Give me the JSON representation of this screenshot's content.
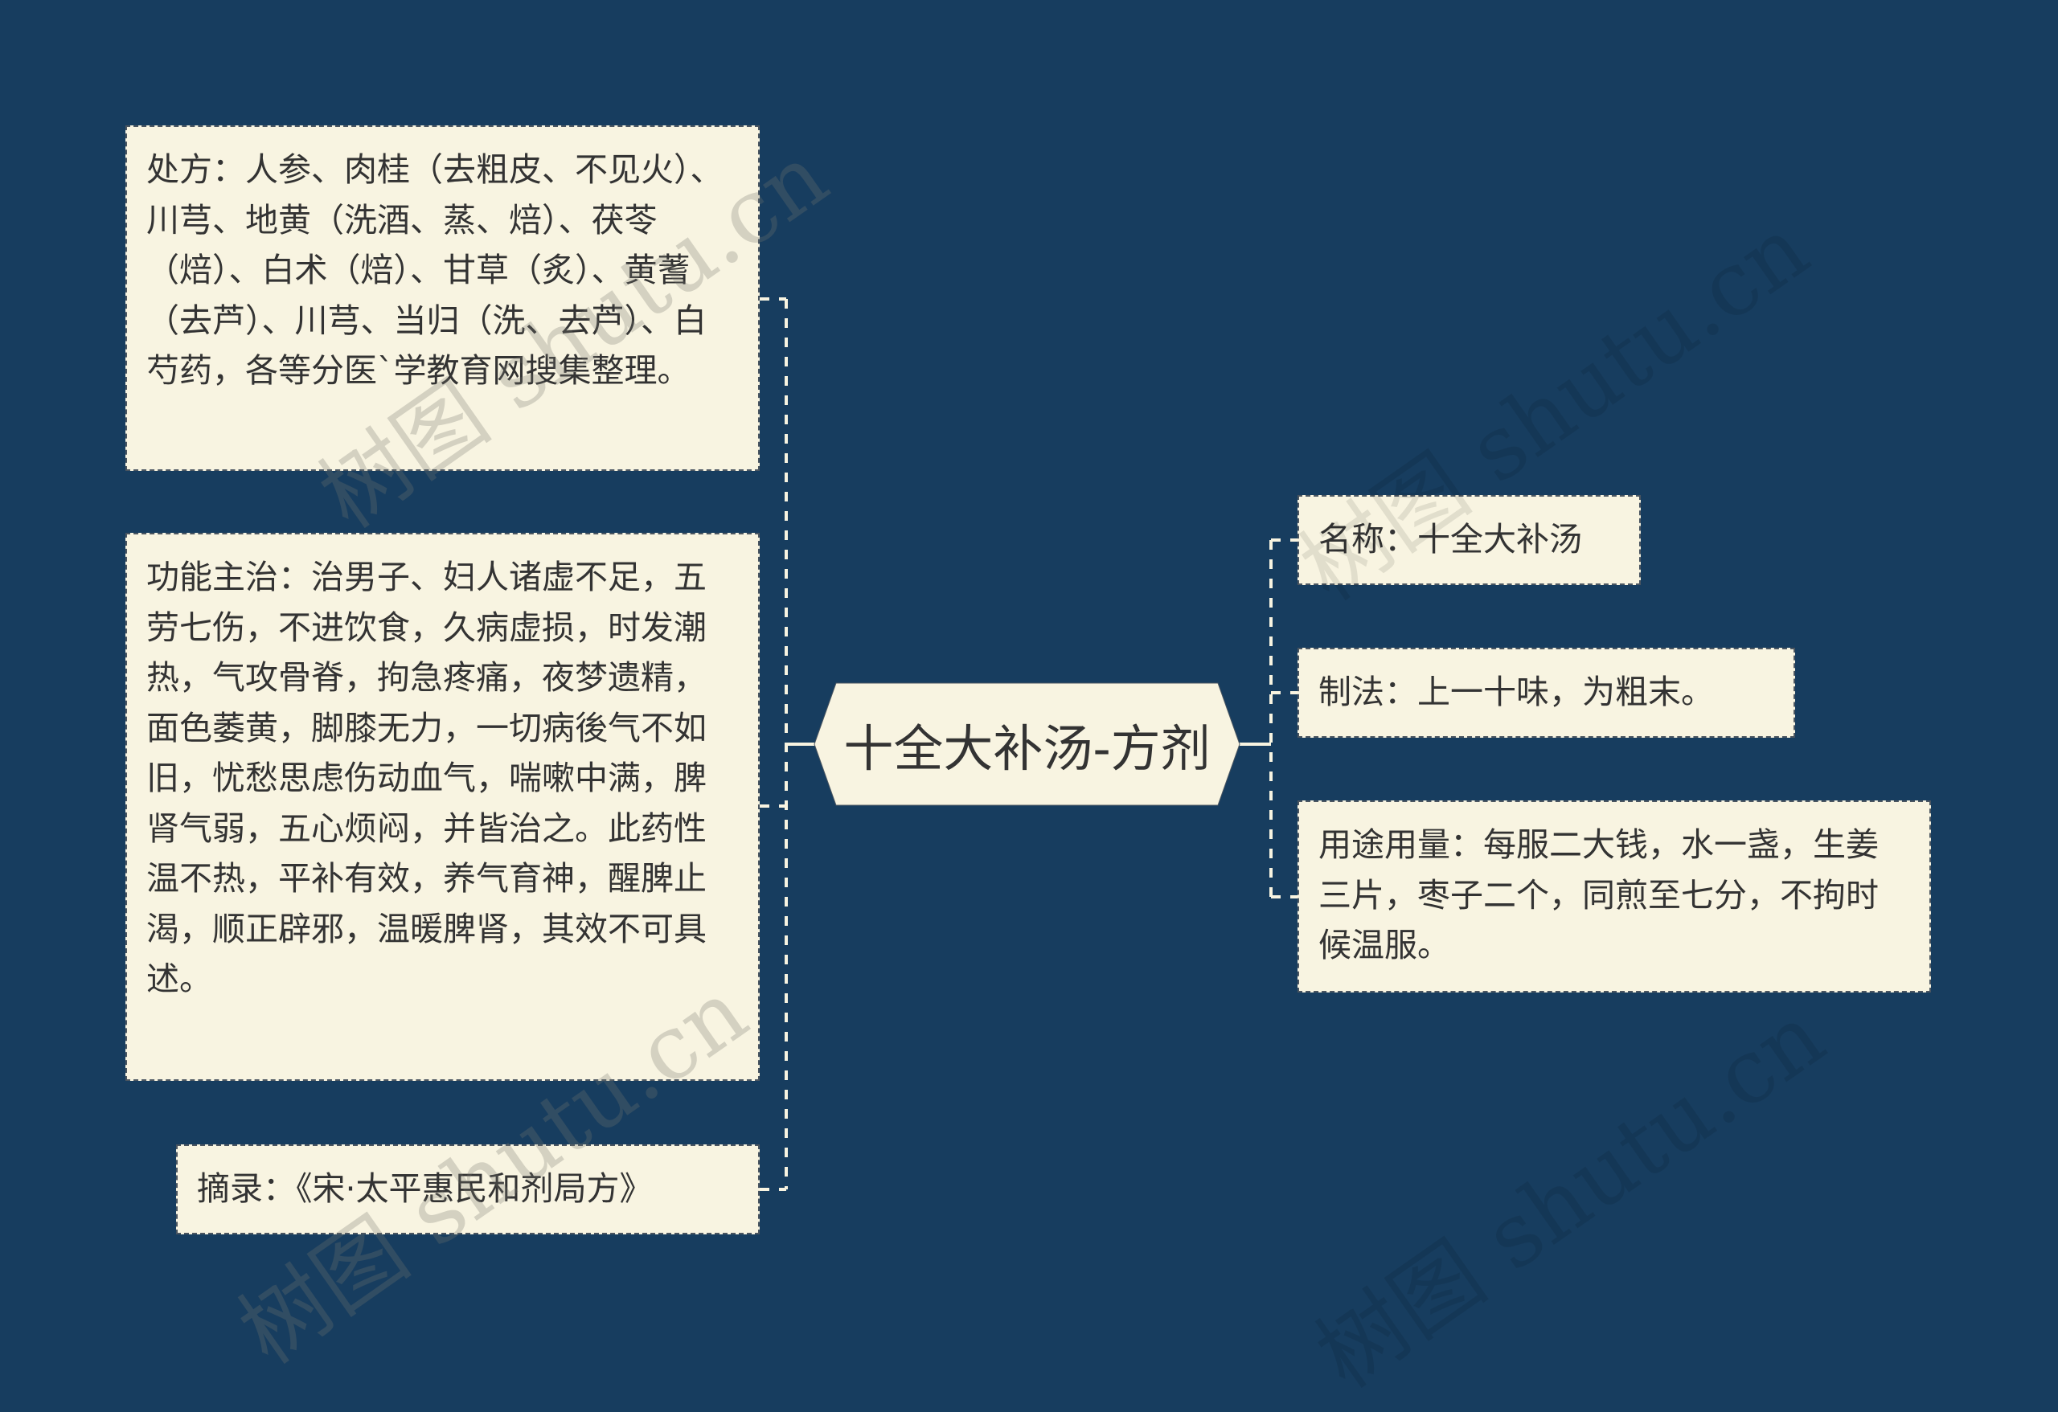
{
  "diagram": {
    "type": "mind-map",
    "colors": {
      "background": "#173d5f",
      "node_fill": "#f8f4e1",
      "node_border": "#4a5560",
      "text": "#333333",
      "connector": "#f8f4e1"
    },
    "center": {
      "title": "十全大补汤-方剂"
    },
    "left_branches": [
      {
        "id": "prescription",
        "text": "处方：人参、肉桂（去粗皮、不见火）、川芎、地黄（洗酒、蒸、焙）、茯苓（焙）、白术（焙）、甘草（炙）、黄蓍（去芦）、川芎、当归（洗、去芦）、白芍药，各等分医`学教育网搜集整理。"
      },
      {
        "id": "indications",
        "text": "功能主治：治男子、妇人诸虚不足，五劳七伤，不进饮食，久病虚损，时发潮热，气攻骨脊，拘急疼痛，夜梦遗精，面色萎黄，脚膝无力，一切病後气不如旧，忧愁思虑伤动血气，喘嗽中满，脾肾气弱，五心烦闷，并皆治之。此药性温不热，平补有效，养气育神，醒脾止渴，顺正辟邪，温暖脾肾，其效不可具述。"
      },
      {
        "id": "source",
        "text": "摘录：《宋·太平惠民和剂局方》"
      }
    ],
    "right_branches": [
      {
        "id": "name",
        "text": "名称：十全大补汤"
      },
      {
        "id": "preparation",
        "text": "制法：上一十味，为粗末。"
      },
      {
        "id": "usage",
        "text": "用途用量：每服二大钱，水一盏，生姜三片，枣子二个，同煎至七分，不拘时候温服。"
      }
    ]
  },
  "watermark": {
    "text_latin": "shutu.cn",
    "text_cn": "树图"
  }
}
